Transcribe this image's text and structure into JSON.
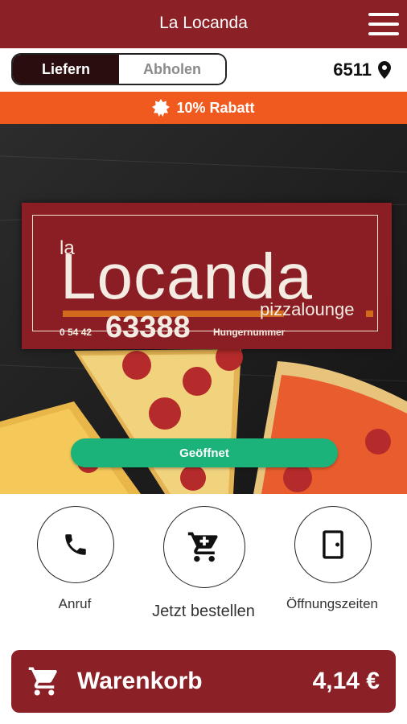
{
  "header": {
    "title": "La Locanda"
  },
  "delivery_toggle": {
    "deliver": "Liefern",
    "pickup": "Abholen"
  },
  "location": {
    "zip": "6511"
  },
  "promo": {
    "text": "10% Rabatt"
  },
  "logo": {
    "la": "la",
    "name": "Locanda",
    "subtitle": "pizzalounge",
    "phone_prefix": "0 54 42",
    "phone_number": "63388",
    "hotline_label": "Hungernummer"
  },
  "status": {
    "label": "Geöffnet"
  },
  "actions": [
    {
      "label": "Anruf"
    },
    {
      "label": "Jetzt bestellen"
    },
    {
      "label": "Öffnungszeiten"
    }
  ],
  "cart": {
    "label": "Warenkorb",
    "total": "4,14 €"
  },
  "colors": {
    "primary": "#8b2126",
    "promo": "#f05a1e",
    "open": "#1bb37a"
  }
}
